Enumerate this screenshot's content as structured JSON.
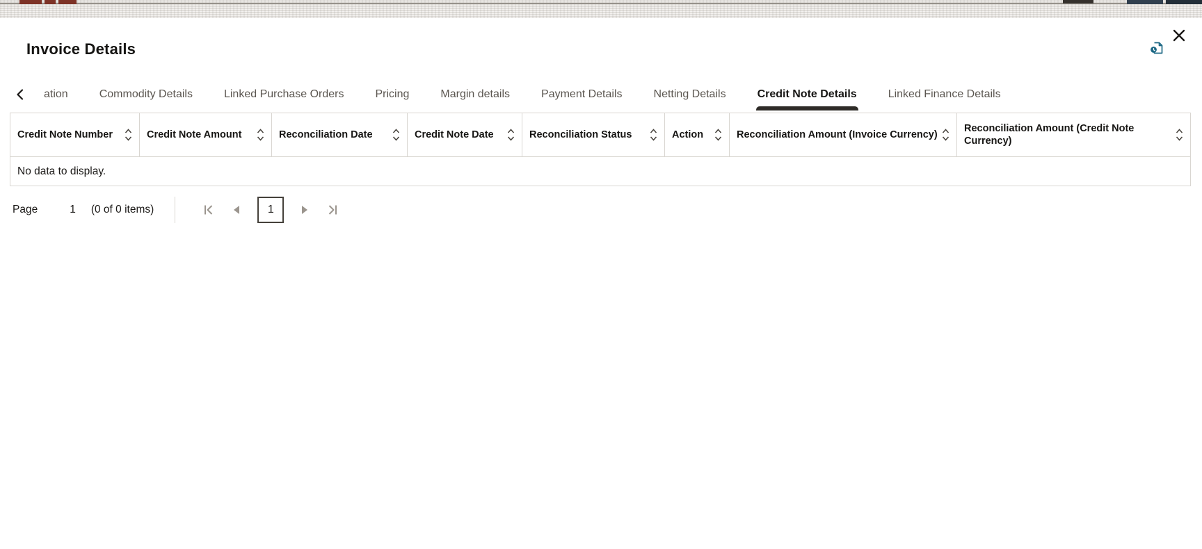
{
  "modal": {
    "title": "Invoice Details",
    "close_icon": "✕",
    "document_icon": "document-audit-icon"
  },
  "tabs": {
    "scroll_left_icon": "‹",
    "items": [
      {
        "label": "ation",
        "active": false
      },
      {
        "label": "Commodity Details",
        "active": false
      },
      {
        "label": "Linked Purchase Orders",
        "active": false
      },
      {
        "label": "Pricing",
        "active": false
      },
      {
        "label": "Margin details",
        "active": false
      },
      {
        "label": "Payment Details",
        "active": false
      },
      {
        "label": "Netting Details",
        "active": false
      },
      {
        "label": "Credit Note Details",
        "active": true
      },
      {
        "label": "Linked Finance Details",
        "active": false
      }
    ]
  },
  "table": {
    "sort_icon": "⌃⌄",
    "columns": [
      {
        "label": "Credit Note Number"
      },
      {
        "label": "Credit Note Amount"
      },
      {
        "label": "Reconciliation Date"
      },
      {
        "label": "Credit Note Date"
      },
      {
        "label": "Reconciliation Status"
      },
      {
        "label": "Action"
      },
      {
        "label": "Reconciliation Amount (Invoice Currency)"
      },
      {
        "label": "Reconciliation Amount (Credit Note Currency)"
      }
    ],
    "rows": [],
    "empty_message": "No data to display."
  },
  "pagination": {
    "page_label": "Page",
    "current_page": "1",
    "items_summary": "(0 of 0 items)",
    "page_button": "1",
    "first_icon": "|‹",
    "prev_icon": "◀",
    "next_icon": "▶",
    "last_icon": "›|"
  },
  "colors": {
    "text": "#161513",
    "tab_inactive": "#5b5650",
    "active_underline": "#2e2b27",
    "table_border": "#d9d6d1",
    "disabled_icon": "#9b958e",
    "document_icon_teal": "#1d6885",
    "top_band": "#e6e3df",
    "band_fragment_red": "#7d3226"
  }
}
